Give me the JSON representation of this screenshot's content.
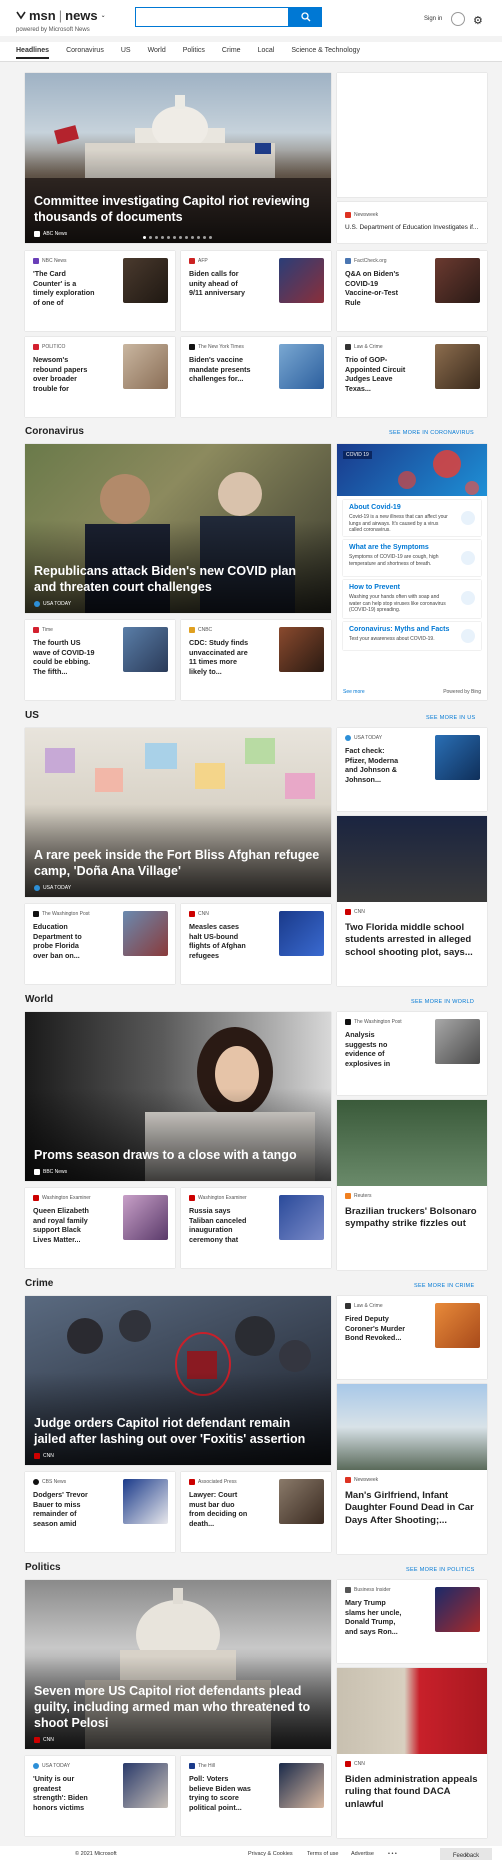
{
  "header": {
    "brand": "msn",
    "product": "news",
    "powered_by": "powered by Microsoft News",
    "search_placeholder": "",
    "signin": "Sign in"
  },
  "nav": [
    "Headlines",
    "Coronavirus",
    "US",
    "World",
    "Politics",
    "Crime",
    "Local",
    "Science & Technology"
  ],
  "headlines": {
    "hero": {
      "title": "Committee investigating Capitol riot reviewing thousands of documents",
      "source": "ABC News"
    },
    "side_tall": {
      "source": "Newsweek",
      "title": "U.S. Department of Education Investigates if..."
    },
    "small": [
      {
        "source": "NBC News",
        "title": "'The Card Counter' is a timely exploration of one of America's..."
      },
      {
        "source": "AFP",
        "title": "Biden calls for unity ahead of 9/11 anniversary"
      },
      {
        "source": "FactCheck.org",
        "title": "Q&A on Biden's COVID-19 Vaccine-or-Test Rule"
      },
      {
        "source": "POLITICO",
        "title": "Newsom's rebound papers over broader trouble for Democrats"
      },
      {
        "source": "The New York Times",
        "title": "Biden's vaccine mandate presents challenges for..."
      },
      {
        "source": "Law & Crime",
        "title": "Trio of GOP-Appointed Circuit Judges Leave Texas..."
      }
    ]
  },
  "coronavirus": {
    "heading": "Coronavirus",
    "see_more": "SEE MORE IN CORONAVIRUS",
    "hero": {
      "title": "Republicans attack Biden's new COVID plan and threaten court challenges",
      "source": "USA TODAY"
    },
    "widget": {
      "badge": "COVID 19",
      "items": [
        {
          "title": "About Covid-19",
          "text": "Covid-19 is a new illness that can affect your lungs and airways. It's caused by a virus called coronavirus."
        },
        {
          "title": "What are the Symptoms",
          "text": "Symptoms of COVID-19 are cough, high temperature and shortness of breath."
        },
        {
          "title": "How to Prevent",
          "text": "Washing your hands often with soap and water can help stop viruses like coronavirus (COVID-19) spreading."
        },
        {
          "title": "Coronavirus: Myths and Facts",
          "text": "Test your awareness about COVID-19."
        }
      ],
      "see_more": "See more",
      "powered": "Powered by Bing"
    },
    "small": [
      {
        "source": "Time",
        "title": "The fourth US wave of COVID-19 could be ebbing. The fifth..."
      },
      {
        "source": "CNBC",
        "title": "CDC: Study finds unvaccinated are 11 times more likely to..."
      }
    ]
  },
  "us": {
    "heading": "US",
    "see_more": "SEE MORE IN US",
    "hero": {
      "title": "A rare peek inside the Fort Bliss Afghan refugee camp, 'Doña Ana Village'",
      "source": "USA TODAY"
    },
    "side_small": {
      "source": "USA TODAY",
      "title": "Fact check: Pfizer, Moderna and Johnson & Johnson..."
    },
    "side_tall": {
      "source": "CNN",
      "title": "Two Florida middle school students arrested in alleged school shooting plot, says..."
    },
    "small": [
      {
        "source": "The Washington Post",
        "title": "Education Department to probe Florida over ban on..."
      },
      {
        "source": "CNN",
        "title": "Measles cases halt US-bound flights of Afghan refugees"
      }
    ]
  },
  "world": {
    "heading": "World",
    "see_more": "SEE MORE IN WORLD",
    "hero": {
      "title": "Proms season draws to a close with a tango",
      "source": "BBC News"
    },
    "side_small": {
      "source": "The Washington Post",
      "title": "Analysis suggests no evidence of explosives in target ..."
    },
    "side_tall": {
      "source": "Reuters",
      "title": "Brazilian truckers' Bolsonaro sympathy strike fizzles out"
    },
    "small": [
      {
        "source": "Washington Examiner",
        "title": "Queen Elizabeth and royal family support Black Lives Matter..."
      },
      {
        "source": "Washington Examiner",
        "title": "Russia says Taliban canceled inauguration ceremony that was..."
      }
    ]
  },
  "crime": {
    "heading": "Crime",
    "see_more": "SEE MORE IN CRIME",
    "hero": {
      "title": "Judge orders Capitol riot defendant remain jailed after lashing out over 'Foxitis' assertion",
      "source": "CNN"
    },
    "side_small": {
      "source": "Law & Crime",
      "title": "Fired Deputy Coroner's Murder Bond Revoked..."
    },
    "side_tall": {
      "source": "Newsweek",
      "title": "Man's Girlfriend, Infant Daughter Found Dead in Car Days After Shooting;..."
    },
    "small": [
      {
        "source": "CBS News",
        "title": "Dodgers' Trevor Bauer to miss remainder of season amid sex..."
      },
      {
        "source": "Associated Press",
        "title": "Lawyer: Court must bar duo from deciding on death..."
      }
    ]
  },
  "politics": {
    "heading": "Politics",
    "see_more": "SEE MORE IN POLITICS",
    "hero": {
      "title": "Seven more US Capitol riot defendants plead guilty, including armed man who threatened to shoot Pelosi",
      "source": "CNN"
    },
    "side_small": {
      "source": "Business Insider",
      "title": "Mary Trump slams her uncle, Donald Trump, and says Ron..."
    },
    "side_tall": {
      "source": "CNN",
      "title": "Biden administration appeals ruling that found DACA unlawful"
    },
    "small": [
      {
        "source": "USA TODAY",
        "title": "'Unity is our greatest strength': Biden honors victims ahea..."
      },
      {
        "source": "The Hill",
        "title": "Poll: Voters believe Biden was trying to score political point..."
      }
    ]
  },
  "footer": {
    "copyright": "© 2021 Microsoft",
    "privacy": "Privacy & Cookies",
    "terms": "Terms of use",
    "advertise": "Advertise",
    "more": "• • •",
    "feedback": "Feedback"
  }
}
